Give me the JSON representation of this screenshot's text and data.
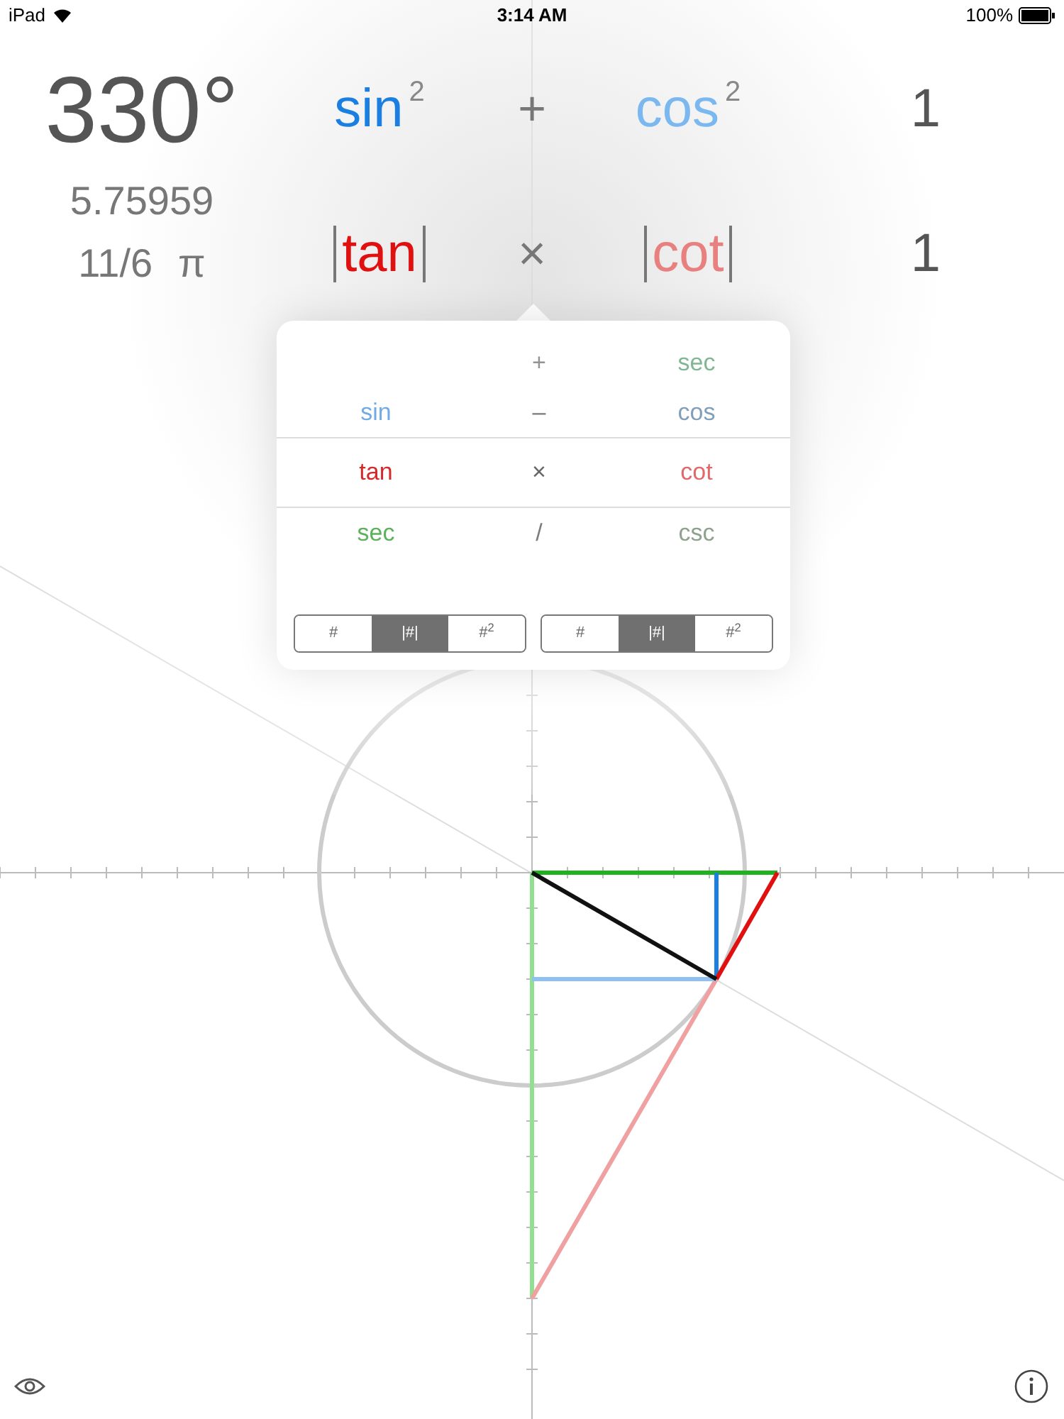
{
  "status_bar": {
    "device": "iPad",
    "time": "3:14 AM",
    "battery": "100%"
  },
  "angle": {
    "degrees": "330°",
    "radians": "5.75959",
    "fraction": "11/6",
    "pi": "π"
  },
  "identities": [
    {
      "left": {
        "name": "sin",
        "kind": "power",
        "power": "2",
        "color": "#1a7fe0"
      },
      "operator": "+",
      "right": {
        "name": "cos",
        "kind": "power",
        "power": "2",
        "color": "#7ab8ef"
      },
      "result": "1"
    },
    {
      "left": {
        "name": "tan",
        "kind": "abs",
        "color": "#e01010"
      },
      "operator": "×",
      "right": {
        "name": "cot",
        "kind": "abs",
        "color": "#e88080"
      },
      "result": "1"
    }
  ],
  "picker": {
    "rows": [
      {
        "operator": "+",
        "right": "sec",
        "selected": false
      },
      {
        "left": "sin",
        "operator": "–",
        "right": "cos",
        "selected": false
      },
      {
        "left": "tan",
        "operator": "×",
        "right": "cot",
        "selected": true
      },
      {
        "left": "sec",
        "operator": "/",
        "right": "csc",
        "selected": false
      }
    ],
    "segments": [
      [
        {
          "label": "#",
          "selected": false
        },
        {
          "label": "|#|",
          "selected": true
        },
        {
          "label": "#$^{2}$",
          "selected": false
        }
      ],
      [
        {
          "label": "#",
          "selected": false
        },
        {
          "label": "|#|",
          "selected": true
        },
        {
          "label": "#$^{2}$",
          "selected": false
        }
      ]
    ]
  }
}
